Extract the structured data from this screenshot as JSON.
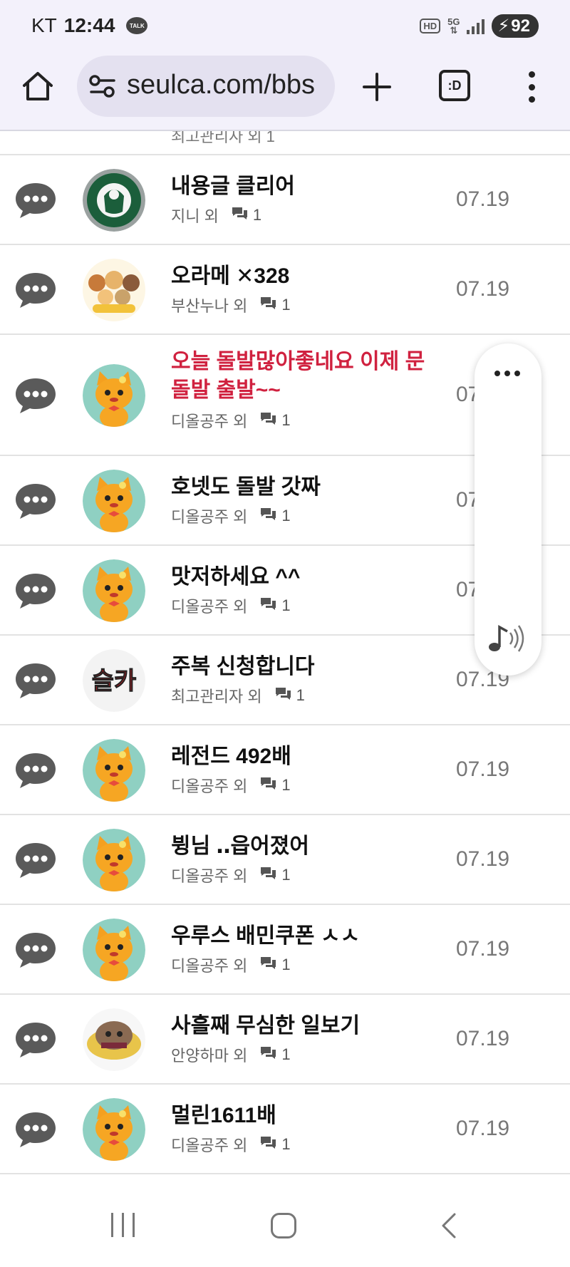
{
  "status_bar": {
    "carrier": "KT",
    "time": "12:44",
    "talk_badge": "TALK",
    "hd_label": "HD",
    "network_label": "5G",
    "battery": "92"
  },
  "browser": {
    "url": "seulca.com/bbs",
    "tab_switcher_label": ":D"
  },
  "partial_row_text": "최고관리자 외 1",
  "posts": [
    {
      "title": "내용글 클리어",
      "author": "지니 외",
      "count": "1",
      "date": "07.19",
      "title_color": "#111111",
      "avatar": "starbucks-logo"
    },
    {
      "title": "오라메 ✕328",
      "author": "부산누나 외",
      "count": "1",
      "date": "07.19",
      "title_color": "#111111",
      "avatar": "cartoon-group"
    },
    {
      "title": "오늘 돌발많아좋네요 이제 문돌발 출발~~",
      "author": "디올공주 외",
      "count": "1",
      "date": "07.19",
      "title_color": "#d0213f",
      "avatar": "orange-cat"
    },
    {
      "title": "호넷도 돌발 갓짜",
      "author": "디올공주 외",
      "count": "1",
      "date": "07.19",
      "title_color": "#111111",
      "avatar": "orange-cat"
    },
    {
      "title": "맛저하세요 ^^",
      "author": "디올공주 외",
      "count": "1",
      "date": "07.19",
      "title_color": "#111111",
      "avatar": "orange-cat"
    },
    {
      "title": "주복 신청합니다",
      "author": "최고관리자 외",
      "count": "1",
      "date": "07.19",
      "title_color": "#111111",
      "avatar": "seulca-logo",
      "avatar_text": "슬카"
    },
    {
      "title": "레전드 492배",
      "author": "디올공주 외",
      "count": "1",
      "date": "07.19",
      "title_color": "#111111",
      "avatar": "orange-cat"
    },
    {
      "title": "뷩님 ‥읍어졌어",
      "author": "디올공주 외",
      "count": "1",
      "date": "07.19",
      "title_color": "#111111",
      "avatar": "orange-cat"
    },
    {
      "title": "우루스 배민쿠폰 ㅅㅅ",
      "author": "디올공주 외",
      "count": "1",
      "date": "07.19",
      "title_color": "#111111",
      "avatar": "orange-cat"
    },
    {
      "title": "사흘째 무심한 일보기",
      "author": "안양하마 외",
      "count": "1",
      "date": "07.19",
      "title_color": "#111111",
      "avatar": "cat-in-box"
    },
    {
      "title": "멀린1611배",
      "author": "디올공주 외",
      "count": "1",
      "date": "07.19",
      "title_color": "#111111",
      "avatar": "orange-cat"
    }
  ]
}
